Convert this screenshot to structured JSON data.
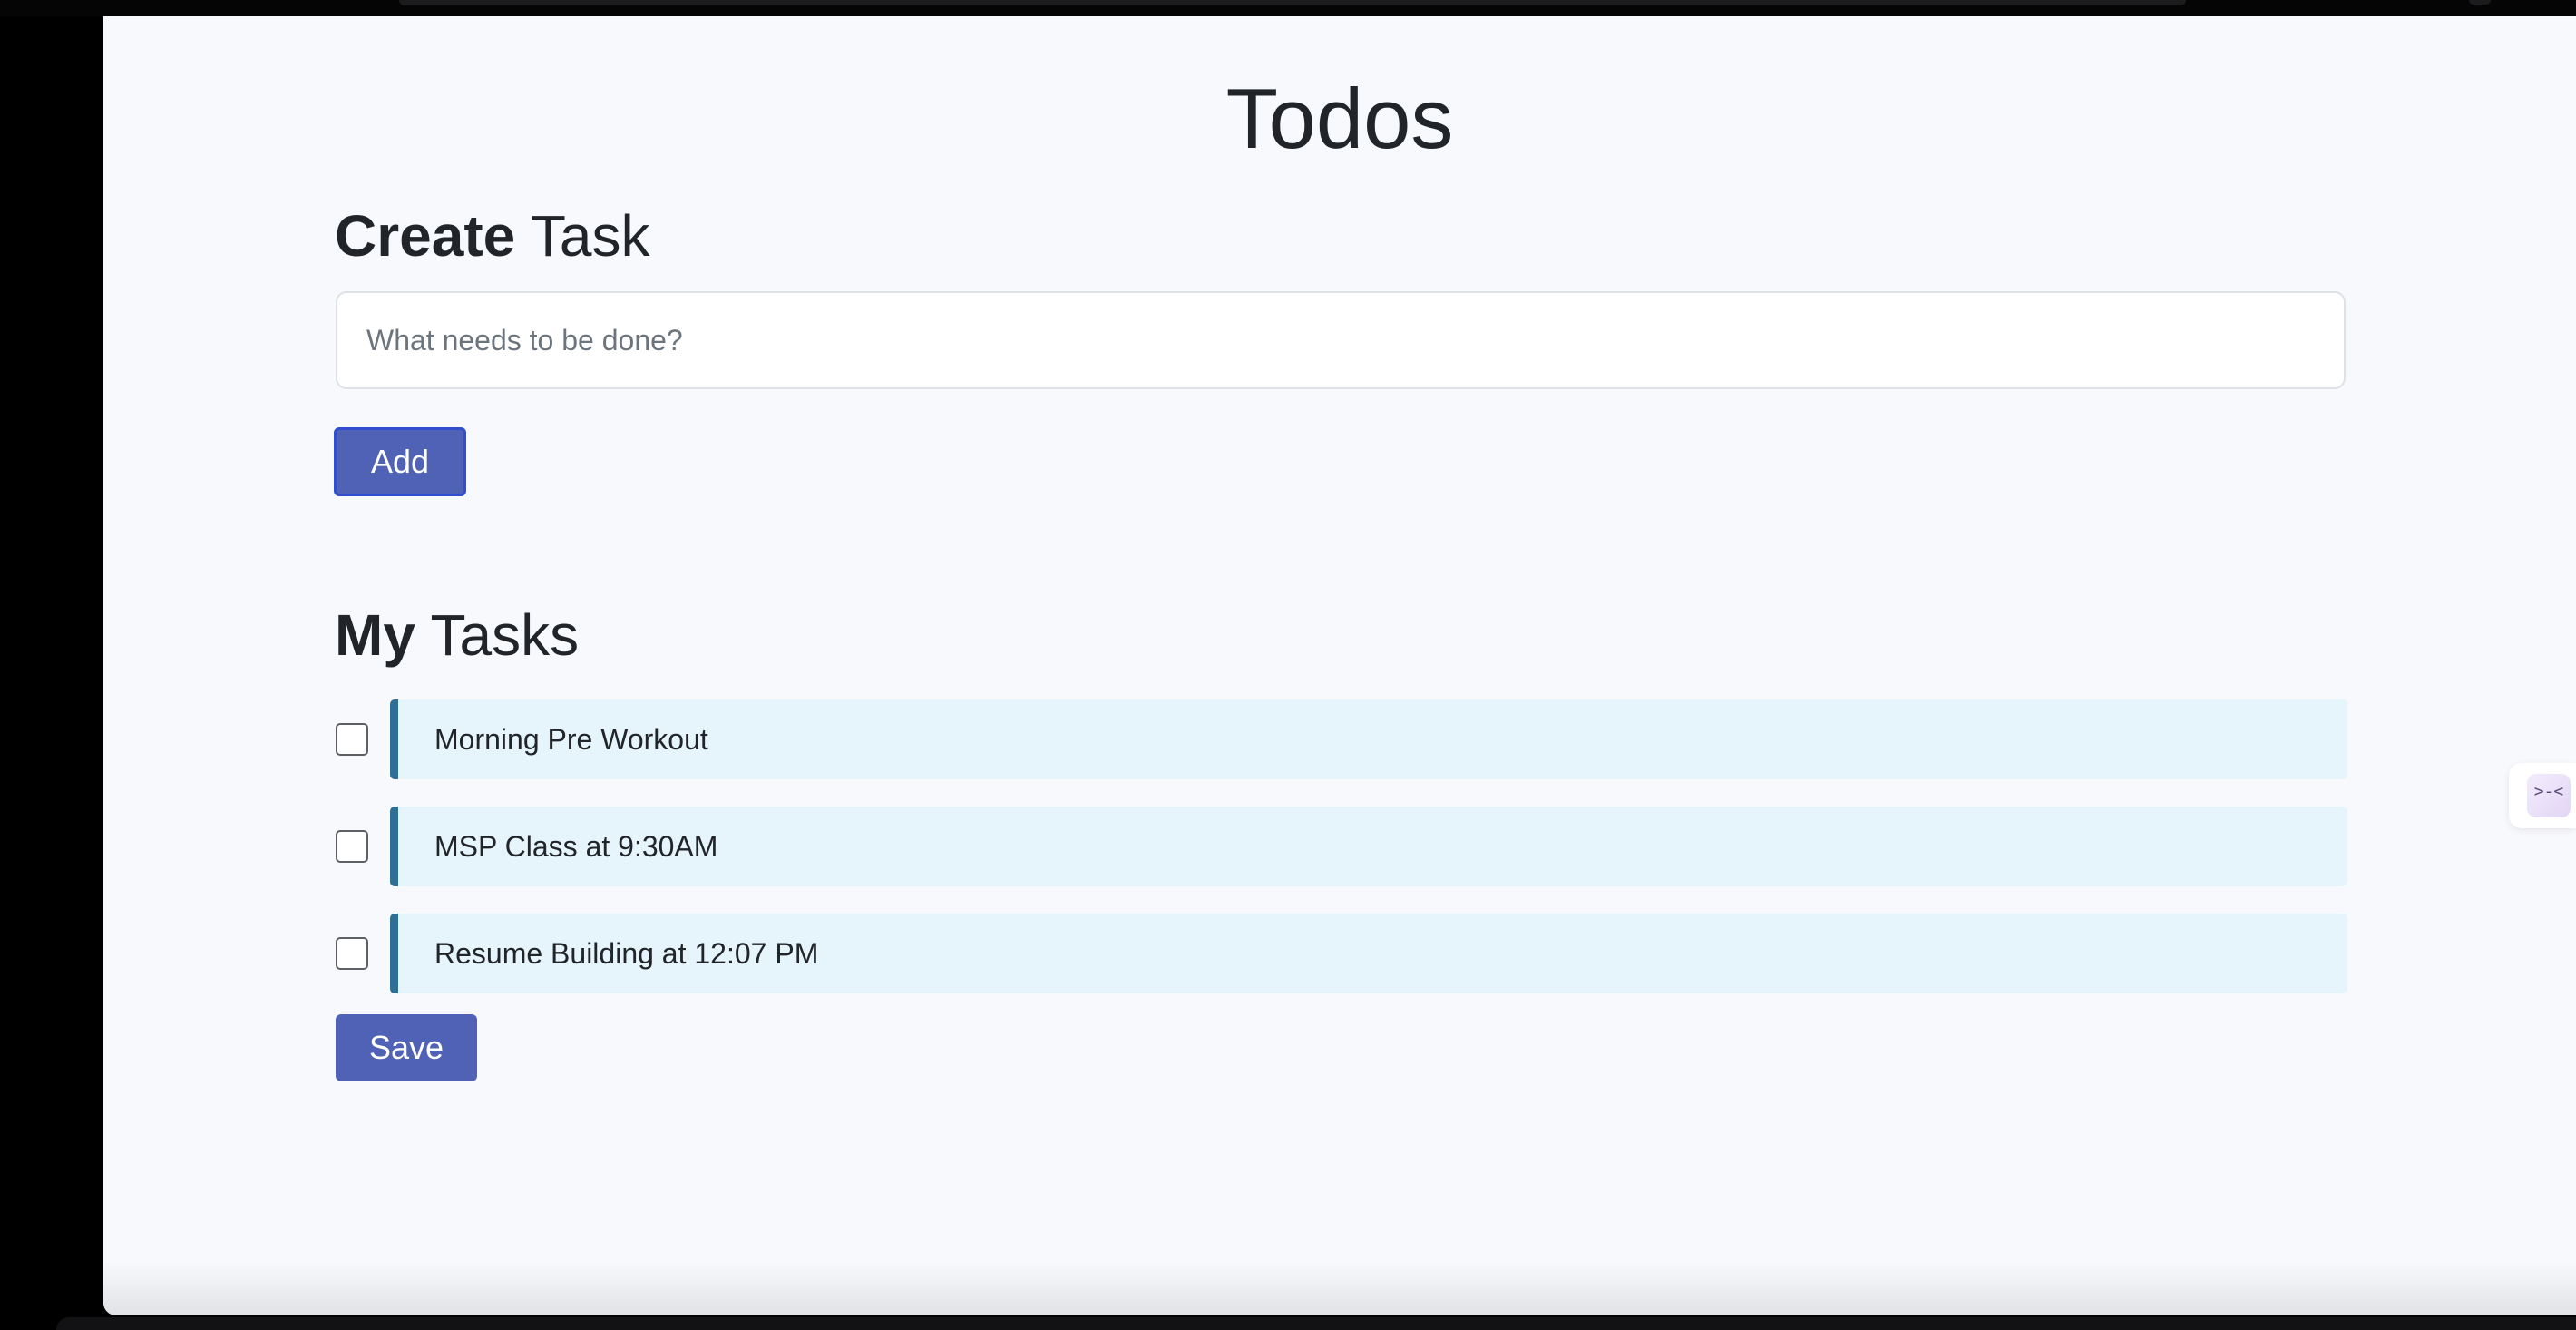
{
  "app": {
    "title": "Todos"
  },
  "create_section": {
    "heading_bold": "Create",
    "heading_rest": " Task",
    "input_placeholder": "What needs to be done?",
    "input_value": "",
    "add_label": "Add"
  },
  "tasks_section": {
    "heading_bold": "My",
    "heading_rest": " Tasks",
    "tasks": [
      {
        "label": "Morning Pre Workout",
        "checked": false
      },
      {
        "label": "MSP Class at 9:30AM",
        "checked": false
      },
      {
        "label": "Resume Building at 12:07 PM",
        "checked": false
      }
    ],
    "save_label": "Save"
  },
  "side_widget": {
    "icon": "collapse-arrows-icon",
    "glyph": ">-<"
  },
  "colors": {
    "primary_button": "#4f62b5",
    "task_card_bg": "#e6f4fc",
    "task_card_accent": "#2f6e95",
    "page_bg": "#f8f9fd"
  }
}
